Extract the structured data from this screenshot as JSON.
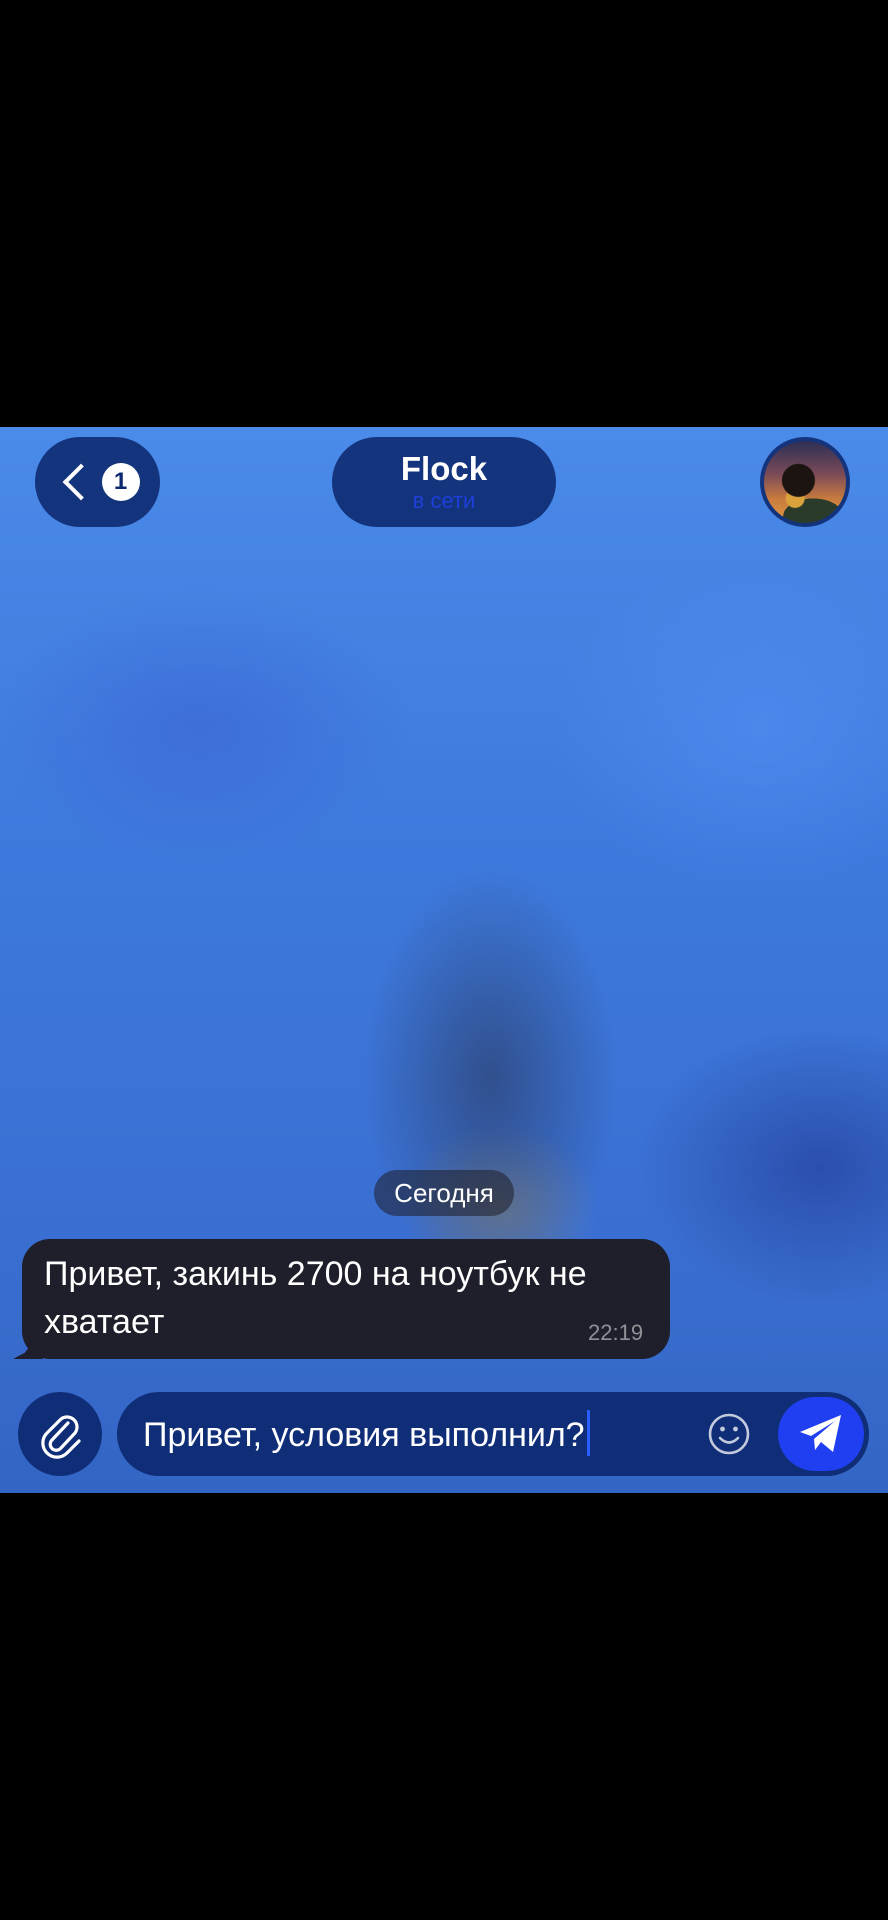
{
  "header": {
    "back_label": "<",
    "unread_count": "1",
    "chat_title": "Flock",
    "chat_status": "в сети",
    "avatar_icon": "contact-avatar"
  },
  "messages": {
    "date_separator": "Сегодня",
    "items": [
      {
        "direction": "incoming",
        "text": "Привет, закинь 2700 на ноутбук не хватает",
        "time": "22:19"
      }
    ]
  },
  "composer": {
    "attach_icon": "paperclip-icon",
    "input_value": "Привет, условия выполнил?",
    "emoji_icon": "smiley-icon",
    "send_icon": "paper-plane-icon"
  },
  "colors": {
    "accent": "#1f3ff0",
    "bubble": "#1e1f2a",
    "chrome": "#0c286e",
    "status": "#1e3fd8"
  }
}
